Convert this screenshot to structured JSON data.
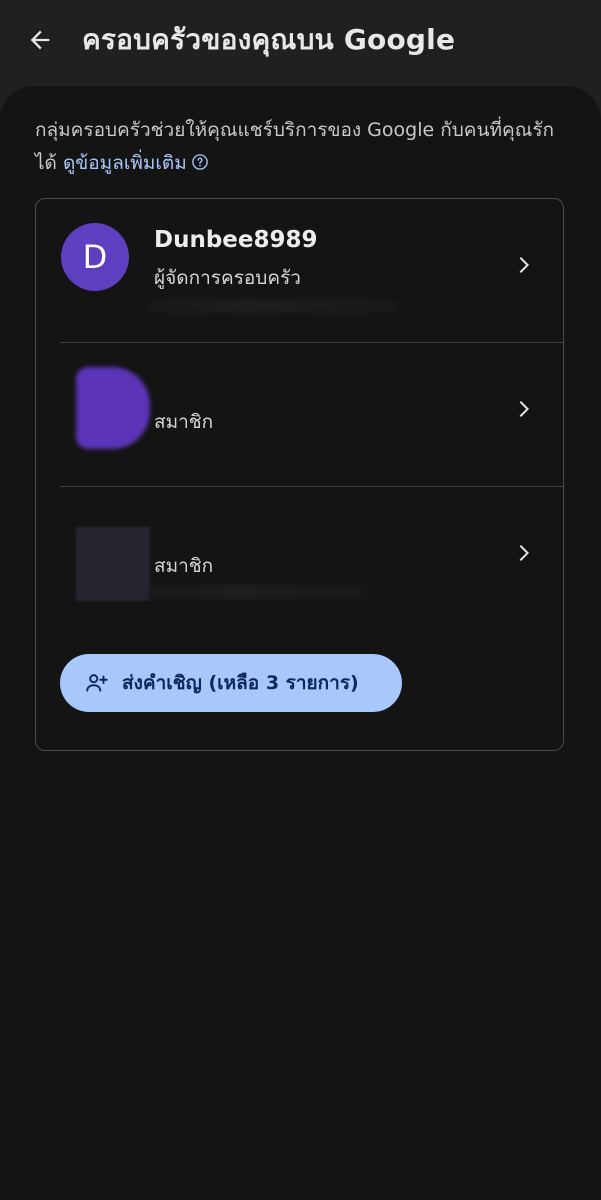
{
  "header": {
    "title": "ครอบครัวของคุณบน Google",
    "back_icon": "arrow-left-icon"
  },
  "intro": {
    "text": "กลุ่มครอบครัวช่วยให้คุณแชร์บริการของ Google กับคนที่คุณรักได้ ",
    "link_label": "ดูข้อมูลเพิ่มเติม",
    "help_icon": "help-circle-icon"
  },
  "members": [
    {
      "name": "Dunbee8989",
      "role": "ผู้จัดการครอบครัว",
      "avatar_letter": "D",
      "avatar_color": "#5d3fbf"
    },
    {
      "name": "",
      "role": "สมาชิก",
      "avatar_color": "#5b34b8"
    },
    {
      "name": "",
      "role": "สมาชิก",
      "avatar_color": "#262630"
    }
  ],
  "invite": {
    "label": "ส่งคำเชิญ (เหลือ 3 รายการ)",
    "icon": "person-add-icon"
  },
  "colors": {
    "accent": "#a8c7fa",
    "background": "#141414",
    "topbar": "#1f2022"
  }
}
